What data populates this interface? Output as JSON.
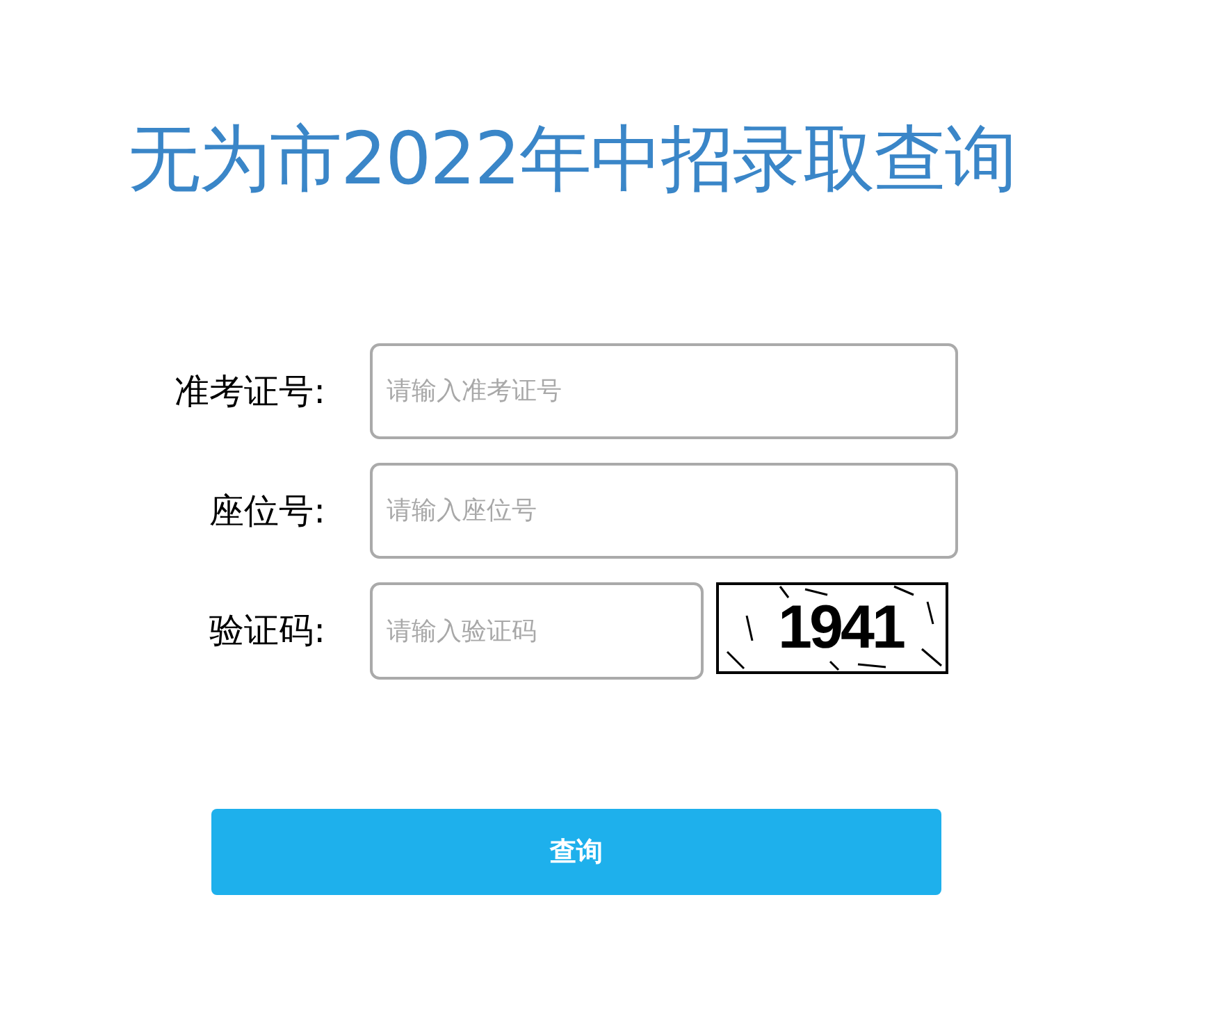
{
  "title": "无为市2022年中招录取查询",
  "fields": [
    {
      "kind": "text",
      "label": "准考证号:",
      "placeholder": "请输入准考证号"
    },
    {
      "kind": "text",
      "label": "座位号:",
      "placeholder": "请输入座位号"
    },
    {
      "kind": "captcha",
      "label": "验证码:",
      "placeholder": "请输入验证码",
      "captcha_text": "1941"
    }
  ],
  "submit": "查询"
}
